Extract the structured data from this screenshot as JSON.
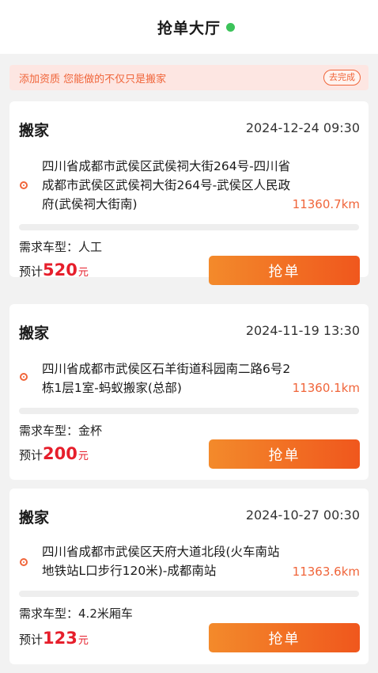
{
  "header": {
    "title": "抢单大厅",
    "status_color": "#3cc35a"
  },
  "banner": {
    "text": "添加资质 您能做的不仅只是搬家",
    "action_label": "去完成"
  },
  "vehicle_label": "需求车型：",
  "price_label": "预计",
  "price_unit": "元",
  "grab_label": "抢单",
  "orders": [
    {
      "type": "搬家",
      "date": "2024-12-24 09:30",
      "address": "四川省成都市武侯区武侯祠大街264号-四川省成都市武侯区武侯祠大街264号-武侯区人民政府(武侯祠大街南)",
      "distance": "11360.7km",
      "vehicle": "人工",
      "price": "520"
    },
    {
      "type": "搬家",
      "date": "2024-11-19 13:30",
      "address": "四川省成都市武侯区石羊街道科园南二路6号2栋1层1室-蚂蚁搬家(总部)",
      "distance": "11360.1km",
      "vehicle": "金杯",
      "price": "200"
    },
    {
      "type": "搬家",
      "date": "2024-10-27 00:30",
      "address": "四川省成都市武侯区天府大道北段(火车南站地铁站L口步行120米)-成都南站",
      "distance": "11363.6km",
      "vehicle": "4.2米厢车",
      "price": "123"
    }
  ]
}
